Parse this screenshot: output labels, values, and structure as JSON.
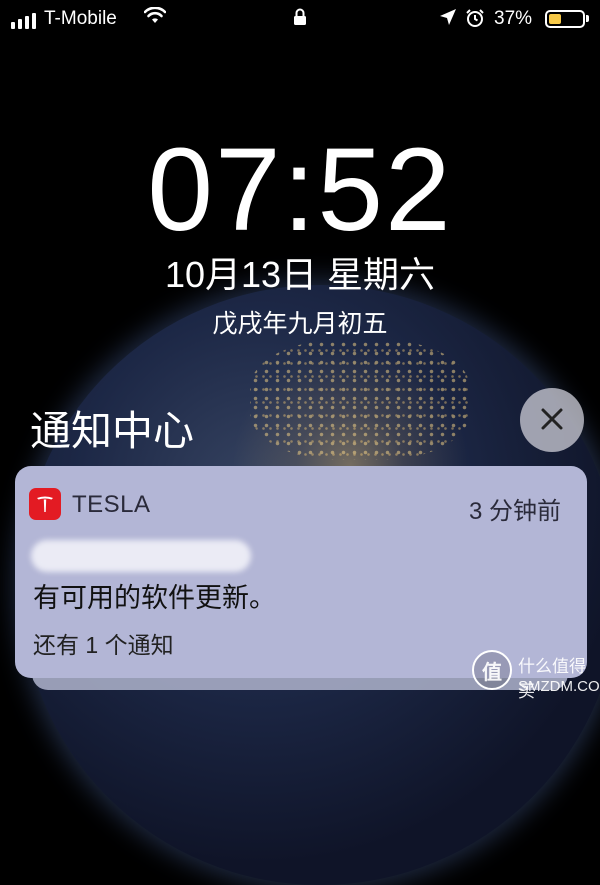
{
  "status_bar": {
    "carrier": "T-Mobile",
    "wifi_icon": "wifi-icon",
    "lock_icon": "lock-icon",
    "location_icon": "location-arrow-icon",
    "alarm_icon": "alarm-clock-icon",
    "battery_percent": "37%",
    "battery_level": 0.37,
    "battery_color": "#f7c948"
  },
  "lock_screen": {
    "time": "07:52",
    "date": "10月13日 星期六",
    "lunar_date": "戊戌年九月初五"
  },
  "notification_center": {
    "title": "通知中心",
    "close_icon": "close-icon"
  },
  "notification": {
    "app_name": "TESLA",
    "app_icon": "tesla-app-icon",
    "time_ago": "3 分钟前",
    "body": "有可用的软件更新。",
    "more": "还有 1 个通知",
    "accent_color": "#e31b23"
  },
  "watermark": {
    "logo_char": "值",
    "line1": "什么值得买",
    "line2": "SMZDM.COM"
  }
}
